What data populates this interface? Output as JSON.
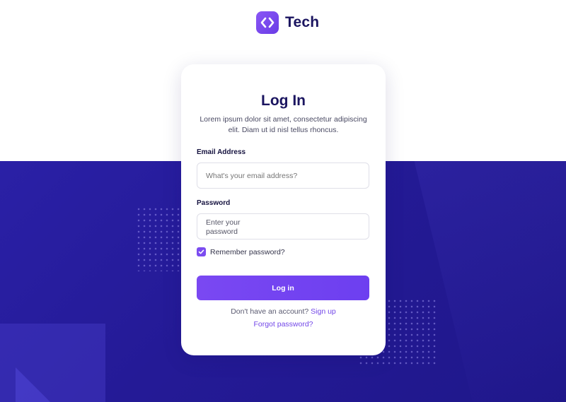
{
  "brand": {
    "name": "Tech",
    "accent": "#7b4cf0",
    "navy": "#1b1560",
    "background_blue": "#241a96"
  },
  "login": {
    "title": "Log In",
    "subtitle": "Lorem ipsum dolor sit amet, consectetur adipiscing elit. Diam ut id nisl tellus rhoncus.",
    "email": {
      "label": "Email Address",
      "placeholder": "What's your email address?",
      "value": ""
    },
    "password": {
      "label": "Password",
      "placeholder": "Enter your password",
      "value": ""
    },
    "remember": {
      "label": "Remember password?",
      "checked": true
    },
    "submit_label": "Log in",
    "signup_prompt": "Don't have an account?",
    "signup_link": "Sign up",
    "forgot_link": "Forgot password?"
  },
  "icons": {
    "logo": "code-brackets-icon",
    "checkbox": "checkmark-icon"
  }
}
